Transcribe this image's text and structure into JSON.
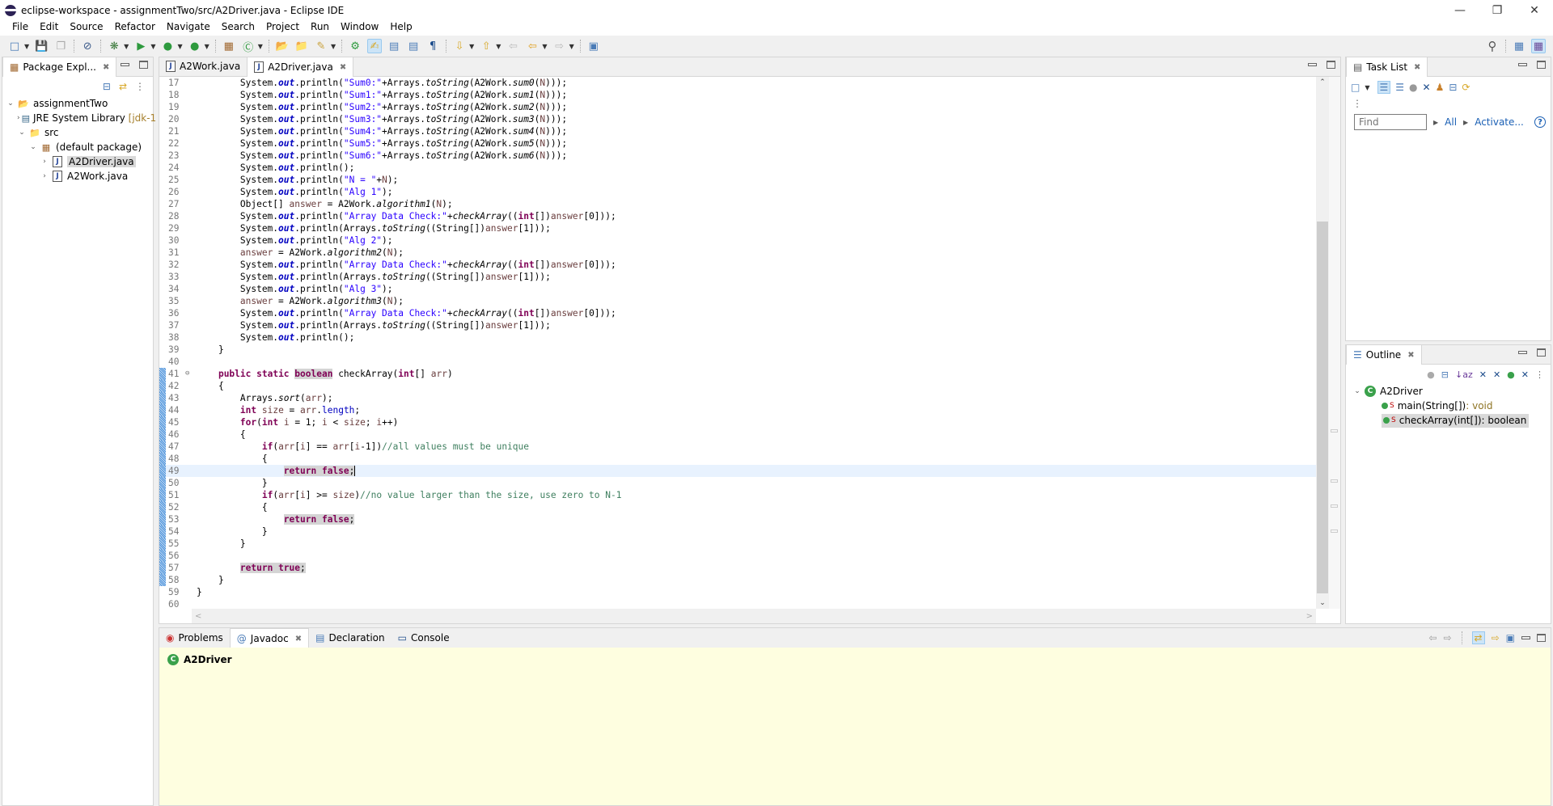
{
  "window": {
    "title": "eclipse-workspace - assignmentTwo/src/A2Driver.java - Eclipse IDE",
    "controls": [
      "minimize",
      "restore",
      "close"
    ]
  },
  "menu": [
    "File",
    "Edit",
    "Source",
    "Refactor",
    "Navigate",
    "Search",
    "Project",
    "Run",
    "Window",
    "Help"
  ],
  "toolbar": {
    "icons": [
      "new-icon",
      "save-icon",
      "save-all-icon",
      "skip-breakpoints-icon",
      "debug-icon",
      "run-icon",
      "coverage-icon",
      "run-external-tools-icon",
      "new-java-package-icon",
      "new-java-class-icon",
      "open-type-icon",
      "open-task-icon",
      "search-icon",
      "toggle-ant-icon",
      "mark-occurrences-icon",
      "block-selection-icon",
      "show-whitespace-icon",
      "pilcrow-icon",
      "next-annotation-icon",
      "prev-annotation-icon",
      "last-edit-icon",
      "back-icon",
      "forward-icon",
      "pin-editor-icon"
    ],
    "right_icons": [
      "search-icon",
      "open-perspective-icon",
      "java-perspective-icon"
    ]
  },
  "package_explorer": {
    "title": "Package Expl...",
    "tree": [
      {
        "label": "assignmentTwo",
        "level": 0,
        "expanded": true,
        "icon": "project-icon"
      },
      {
        "label": "JRE System Library",
        "suffix": "[jdk-1",
        "level": 1,
        "expanded": false,
        "icon": "library-icon"
      },
      {
        "label": "src",
        "level": 1,
        "expanded": true,
        "icon": "source-folder-icon"
      },
      {
        "label": "(default package)",
        "level": 2,
        "expanded": true,
        "icon": "package-icon"
      },
      {
        "label": "A2Driver.java",
        "level": 3,
        "expanded": false,
        "icon": "java-file-icon",
        "selected": true
      },
      {
        "label": "A2Work.java",
        "level": 3,
        "expanded": false,
        "icon": "java-file-icon"
      }
    ]
  },
  "editor": {
    "tabs": [
      {
        "label": "A2Work.java",
        "active": false
      },
      {
        "label": "A2Driver.java",
        "active": true
      }
    ],
    "current_line": 49,
    "lines": [
      {
        "n": "17",
        "html": "        System.<span class='f'>out</span>.println(<span class='s'>\"Sum0:\"</span>+Arrays.<span class='i'>toString</span>(A2Work.<span class='i'>sum0</span>(<span class='v'>N</span>)));"
      },
      {
        "n": "18",
        "html": "        System.<span class='f'>out</span>.println(<span class='s'>\"Sum1:\"</span>+Arrays.<span class='i'>toString</span>(A2Work.<span class='i'>sum1</span>(<span class='v'>N</span>)));"
      },
      {
        "n": "19",
        "html": "        System.<span class='f'>out</span>.println(<span class='s'>\"Sum2:\"</span>+Arrays.<span class='i'>toString</span>(A2Work.<span class='i'>sum2</span>(<span class='v'>N</span>)));"
      },
      {
        "n": "20",
        "html": "        System.<span class='f'>out</span>.println(<span class='s'>\"Sum3:\"</span>+Arrays.<span class='i'>toString</span>(A2Work.<span class='i'>sum3</span>(<span class='v'>N</span>)));"
      },
      {
        "n": "21",
        "html": "        System.<span class='f'>out</span>.println(<span class='s'>\"Sum4:\"</span>+Arrays.<span class='i'>toString</span>(A2Work.<span class='i'>sum4</span>(<span class='v'>N</span>)));"
      },
      {
        "n": "22",
        "html": "        System.<span class='f'>out</span>.println(<span class='s'>\"Sum5:\"</span>+Arrays.<span class='i'>toString</span>(A2Work.<span class='i'>sum5</span>(<span class='v'>N</span>)));"
      },
      {
        "n": "23",
        "html": "        System.<span class='f'>out</span>.println(<span class='s'>\"Sum6:\"</span>+Arrays.<span class='i'>toString</span>(A2Work.<span class='i'>sum6</span>(<span class='v'>N</span>)));"
      },
      {
        "n": "24",
        "html": "        System.<span class='f'>out</span>.println();"
      },
      {
        "n": "25",
        "html": "        System.<span class='f'>out</span>.println(<span class='s'>\"N = \"</span>+<span class='v'>N</span>);"
      },
      {
        "n": "26",
        "html": "        System.<span class='f'>out</span>.println(<span class='s'>\"Alg 1\"</span>);"
      },
      {
        "n": "27",
        "html": "        Object[] <span class='v'>answer</span> = A2Work.<span class='i'>algorithm1</span>(<span class='v'>N</span>);"
      },
      {
        "n": "28",
        "html": "        System.<span class='f'>out</span>.println(<span class='s'>\"Array Data Check:\"</span>+<span class='i'>checkArray</span>((<span class='k'>int</span>[])<span class='v'>answer</span>[0]));"
      },
      {
        "n": "29",
        "html": "        System.<span class='f'>out</span>.println(Arrays.<span class='i'>toString</span>((String[])<span class='v'>answer</span>[1]));"
      },
      {
        "n": "30",
        "html": "        System.<span class='f'>out</span>.println(<span class='s'>\"Alg 2\"</span>);"
      },
      {
        "n": "31",
        "html": "        <span class='v'>answer</span> = A2Work.<span class='i'>algorithm2</span>(<span class='v'>N</span>);"
      },
      {
        "n": "32",
        "html": "        System.<span class='f'>out</span>.println(<span class='s'>\"Array Data Check:\"</span>+<span class='i'>checkArray</span>((<span class='k'>int</span>[])<span class='v'>answer</span>[0]));"
      },
      {
        "n": "33",
        "html": "        System.<span class='f'>out</span>.println(Arrays.<span class='i'>toString</span>((String[])<span class='v'>answer</span>[1]));"
      },
      {
        "n": "34",
        "html": "        System.<span class='f'>out</span>.println(<span class='s'>\"Alg 3\"</span>);"
      },
      {
        "n": "35",
        "html": "        <span class='v'>answer</span> = A2Work.<span class='i'>algorithm3</span>(<span class='v'>N</span>);"
      },
      {
        "n": "36",
        "html": "        System.<span class='f'>out</span>.println(<span class='s'>\"Array Data Check:\"</span>+<span class='i'>checkArray</span>((<span class='k'>int</span>[])<span class='v'>answer</span>[0]));"
      },
      {
        "n": "37",
        "html": "        System.<span class='f'>out</span>.println(Arrays.<span class='i'>toString</span>((String[])<span class='v'>answer</span>[1]));"
      },
      {
        "n": "38",
        "html": "        System.<span class='f'>out</span>.println();"
      },
      {
        "n": "39",
        "html": "    }"
      },
      {
        "n": "40",
        "html": ""
      },
      {
        "n": "41",
        "fold": true,
        "changed": true,
        "html": "    <span class='k'>public</span> <span class='k'>static</span> <span class='k hl'>boolean</span> checkArray(<span class='k'>int</span>[] <span class='v'>arr</span>)"
      },
      {
        "n": "42",
        "changed": true,
        "html": "    {"
      },
      {
        "n": "43",
        "changed": true,
        "html": "        Arrays.<span class='i'>sort</span>(<span class='v'>arr</span>);"
      },
      {
        "n": "44",
        "changed": true,
        "html": "        <span class='k'>int</span> <span class='v'>size</span> = <span class='v'>arr</span>.<span class='fl'>length</span>;"
      },
      {
        "n": "45",
        "changed": true,
        "html": "        <span class='k'>for</span>(<span class='k'>int</span> <span class='v'>i</span> = 1; <span class='v'>i</span> &lt; <span class='v'>size</span>; <span class='v'>i</span>++)"
      },
      {
        "n": "46",
        "changed": true,
        "html": "        {"
      },
      {
        "n": "47",
        "changed": true,
        "html": "            <span class='k'>if</span>(<span class='v'>arr</span>[<span class='v'>i</span>] == <span class='v'>arr</span>[<span class='v'>i</span>-1])<span class='c'>//all values must be unique</span>"
      },
      {
        "n": "48",
        "changed": true,
        "html": "            {"
      },
      {
        "n": "49",
        "changed": true,
        "html": "                <span class='hl'><span class='k'>return</span> <span class='k'>false</span>;</span><span class='caret'></span>"
      },
      {
        "n": "50",
        "changed": true,
        "html": "            }"
      },
      {
        "n": "51",
        "changed": true,
        "html": "            <span class='k'>if</span>(<span class='v'>arr</span>[<span class='v'>i</span>] &gt;= <span class='v'>size</span>)<span class='c'>//no value larger than the size, use zero to N-1</span>"
      },
      {
        "n": "52",
        "changed": true,
        "html": "            {"
      },
      {
        "n": "53",
        "changed": true,
        "html": "                <span class='hl'><span class='k'>return</span> <span class='k'>false</span>;</span>"
      },
      {
        "n": "54",
        "changed": true,
        "html": "            }"
      },
      {
        "n": "55",
        "changed": true,
        "html": "        }"
      },
      {
        "n": "56",
        "changed": true,
        "html": ""
      },
      {
        "n": "57",
        "changed": true,
        "html": "        <span class='hl'><span class='k'>return</span> <span class='k'>true</span>;</span>"
      },
      {
        "n": "58",
        "changed": true,
        "html": "    }"
      },
      {
        "n": "59",
        "html": "}"
      },
      {
        "n": "60",
        "html": ""
      }
    ]
  },
  "task_list": {
    "title": "Task List",
    "find_placeholder": "Find",
    "all_label": "All",
    "activate_label": "Activate...",
    "help": "?"
  },
  "outline": {
    "title": "Outline",
    "root": "A2Driver",
    "members": [
      {
        "name": "main(String[])",
        "type": " : void",
        "static": true
      },
      {
        "name": "checkArray(int[])",
        "type": " : boolean",
        "static": true,
        "selected": true
      }
    ],
    "static_marker": "S"
  },
  "bottom_panel": {
    "tabs": [
      {
        "label": "Problems",
        "active": false
      },
      {
        "label": "Javadoc",
        "active": true
      },
      {
        "label": "Declaration",
        "active": false
      },
      {
        "label": "Console",
        "active": false
      }
    ],
    "javadoc_title": "A2Driver"
  }
}
